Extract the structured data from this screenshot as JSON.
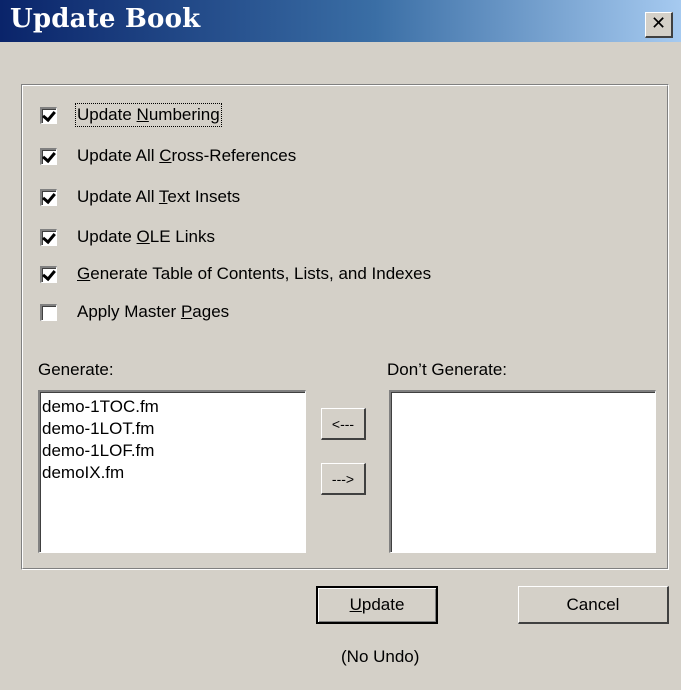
{
  "window": {
    "title": "Update Book",
    "close_glyph": "✕"
  },
  "options": [
    {
      "pre": "Update ",
      "mn": "N",
      "post": "umbering",
      "checked": true
    },
    {
      "pre": "Update All ",
      "mn": "C",
      "post": "ross-References",
      "checked": true
    },
    {
      "pre": "Update All ",
      "mn": "T",
      "post": "ext Insets",
      "checked": true
    },
    {
      "pre": "Update ",
      "mn": "O",
      "post": "LE Links",
      "checked": true
    },
    {
      "pre": "",
      "mn": "G",
      "post": "enerate Table of Contents, Lists, and Indexes",
      "checked": true
    },
    {
      "pre": "Apply Master ",
      "mn": "P",
      "post": "ages",
      "checked": false
    }
  ],
  "generate": {
    "label": "Generate:",
    "items": [
      "demo-1TOC.fm",
      "demo-1LOT.fm",
      "demo-1LOF.fm",
      "demoIX.fm"
    ]
  },
  "dont_generate": {
    "label": "Don’t Generate:",
    "items": []
  },
  "move_left_label": "<---",
  "move_right_label": "--->",
  "update_button": {
    "mn": "U",
    "post": "pdate"
  },
  "cancel_label": "Cancel",
  "note": "(No Undo)"
}
